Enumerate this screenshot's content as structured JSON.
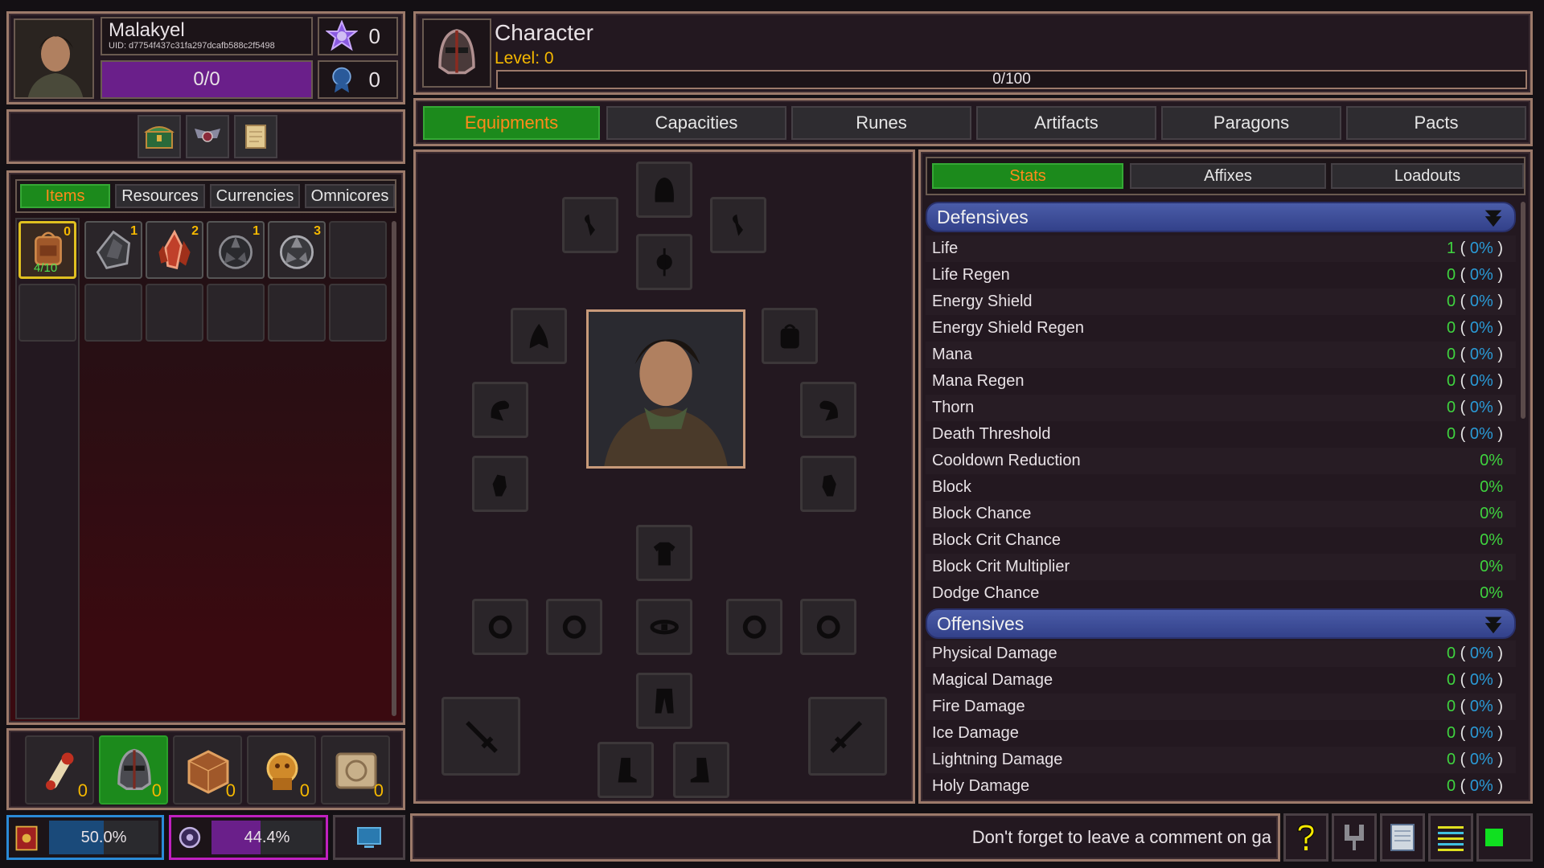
{
  "player": {
    "name": "Malakyel",
    "uid": "UID: d7754f437c31fa297dcafb588c2f5498",
    "bar_text": "0/0",
    "currency1": "0",
    "currency2": "0"
  },
  "character": {
    "title": "Character",
    "level": "Level: 0",
    "xp_text": "0/100"
  },
  "main_tabs": [
    "Equipments",
    "Capacities",
    "Runes",
    "Artifacts",
    "Paragons",
    "Pacts"
  ],
  "inv_tabs": [
    "Items",
    "Resources",
    "Currencies",
    "Omnicores"
  ],
  "inventory": {
    "bag_count": "0",
    "bag_capacity": "4/10",
    "items": [
      {
        "icon": "dark-ore-icon",
        "count": "1"
      },
      {
        "icon": "red-crystal-icon",
        "count": "2"
      },
      {
        "icon": "dark-cluster-icon",
        "count": "1"
      },
      {
        "icon": "grey-cluster-icon",
        "count": "3"
      }
    ]
  },
  "stat_tabs": [
    "Stats",
    "Affixes",
    "Loadouts"
  ],
  "defensives": {
    "title": "Defensives",
    "rows": [
      {
        "label": "Life",
        "value": "1",
        "pct": "0%"
      },
      {
        "label": "Life Regen",
        "value": "0",
        "pct": "0%"
      },
      {
        "label": "Energy Shield",
        "value": "0",
        "pct": "0%"
      },
      {
        "label": "Energy Shield Regen",
        "value": "0",
        "pct": "0%"
      },
      {
        "label": "Mana",
        "value": "0",
        "pct": "0%"
      },
      {
        "label": "Mana Regen",
        "value": "0",
        "pct": "0%"
      },
      {
        "label": "Thorn",
        "value": "0",
        "pct": "0%"
      },
      {
        "label": "Death Threshold",
        "value": "0",
        "pct": "0%"
      },
      {
        "label": "Cooldown Reduction",
        "value": "0%"
      },
      {
        "label": "Block",
        "value": "0%"
      },
      {
        "label": "Block Chance",
        "value": "0%"
      },
      {
        "label": "Block Crit Chance",
        "value": "0%"
      },
      {
        "label": "Block Crit Multiplier",
        "value": "0%"
      },
      {
        "label": "Dodge Chance",
        "value": "0%"
      }
    ]
  },
  "offensives": {
    "title": "Offensives",
    "rows": [
      {
        "label": "Physical Damage",
        "value": "0",
        "pct": "0%"
      },
      {
        "label": "Magical Damage",
        "value": "0",
        "pct": "0%"
      },
      {
        "label": "Fire Damage",
        "value": "0",
        "pct": "0%"
      },
      {
        "label": "Ice Damage",
        "value": "0",
        "pct": "0%"
      },
      {
        "label": "Lightning Damage",
        "value": "0",
        "pct": "0%"
      },
      {
        "label": "Holy Damage",
        "value": "0",
        "pct": "0%"
      }
    ]
  },
  "hotbar": {
    "counts": [
      "0",
      "0",
      "0",
      "0",
      "0"
    ],
    "icons": [
      "scroll-icon",
      "helmet-icon",
      "cube-icon",
      "golden-idol-icon",
      "map-icon"
    ]
  },
  "bottom": {
    "progress1_text": "50.0%",
    "progress1": 0.5,
    "progress2_text": "44.4%",
    "progress2": 0.444,
    "ticker": "Don't forget to leave a comment on ga"
  },
  "colors": {
    "accent_green": "#1c8a1c",
    "tab_active_text": "#ff8a1a",
    "value_green": "#3fd43f",
    "pct_blue": "#2a9ad6",
    "section_blue": "#3d4d9a",
    "purple": "#6a1f8a",
    "border": "#9c7a6a"
  }
}
